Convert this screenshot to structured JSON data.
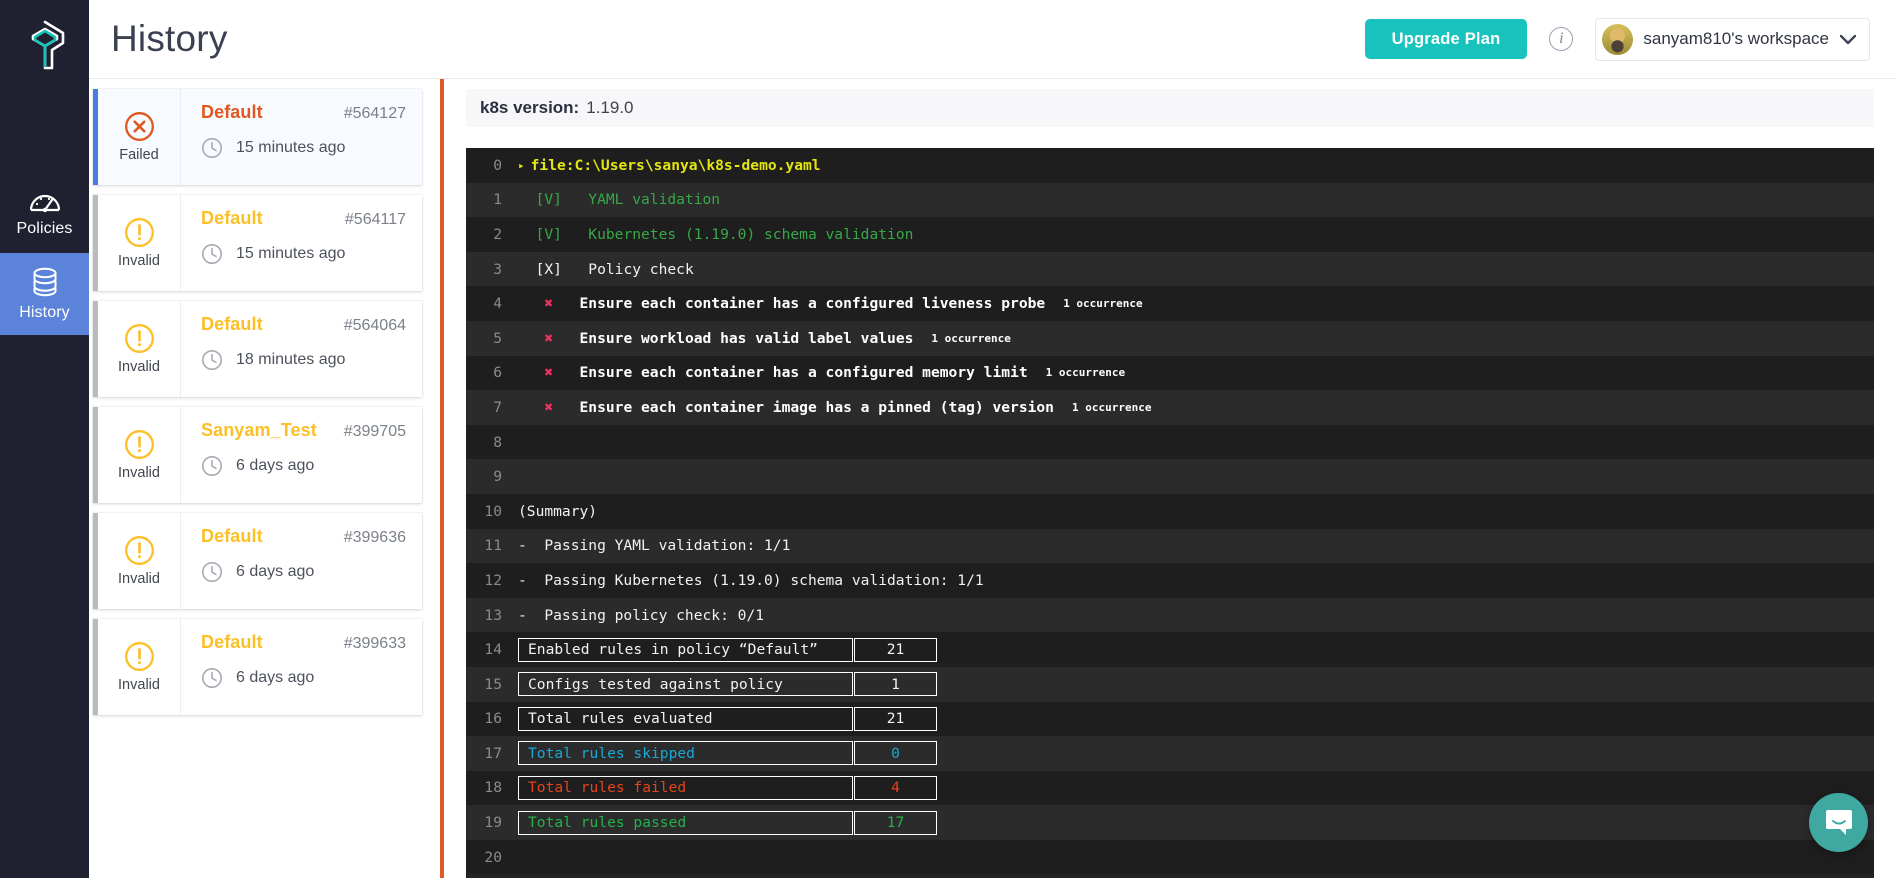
{
  "sidebar": {
    "logo_name": "datree-logo",
    "items": [
      {
        "label": "Policies",
        "icon": "gauge-icon",
        "active": false
      },
      {
        "label": "History",
        "icon": "database-stack-icon",
        "active": true
      }
    ]
  },
  "header": {
    "title": "History",
    "upgrade_label": "Upgrade Plan",
    "info_glyph": "i",
    "workspace_name": "sanyam810's workspace",
    "chevron_glyph": "⌄",
    "accent_teal": "#19c3bd"
  },
  "history": {
    "items": [
      {
        "status": "Failed",
        "status_kind": "failed",
        "policy": "Default",
        "id": "#564127",
        "time": "15 minutes ago",
        "selected": true
      },
      {
        "status": "Invalid",
        "status_kind": "invalid",
        "policy": "Default",
        "id": "#564117",
        "time": "15 minutes ago",
        "selected": false
      },
      {
        "status": "Invalid",
        "status_kind": "invalid",
        "policy": "Default",
        "id": "#564064",
        "time": "18 minutes ago",
        "selected": false
      },
      {
        "status": "Invalid",
        "status_kind": "invalid",
        "policy": "Sanyam_Test",
        "id": "#399705",
        "time": "6 days ago",
        "selected": false
      },
      {
        "status": "Invalid",
        "status_kind": "invalid",
        "policy": "Default",
        "id": "#399636",
        "time": "6 days ago",
        "selected": false
      },
      {
        "status": "Invalid",
        "status_kind": "invalid",
        "policy": "Default",
        "id": "#399633",
        "time": "6 days ago",
        "selected": false
      }
    ]
  },
  "detail": {
    "k8s_label": "k8s version:",
    "k8s_value": "1.19.0",
    "terminal": {
      "lines": [
        {
          "n": "0",
          "kind": "file",
          "text": "file:C:\\Users\\sanya\\k8s-demo.yaml"
        },
        {
          "n": "1",
          "kind": "pass",
          "mark": "[V]",
          "text": "YAML validation"
        },
        {
          "n": "2",
          "kind": "pass",
          "mark": "[V]",
          "text": "Kubernetes (1.19.0) schema validation"
        },
        {
          "n": "3",
          "kind": "failmark",
          "mark": "[X]",
          "text": "Policy check"
        },
        {
          "n": "4",
          "kind": "rule",
          "text": "Ensure each container has a configured liveness probe",
          "occ": "1 occurrence"
        },
        {
          "n": "5",
          "kind": "rule",
          "text": "Ensure workload has valid label values",
          "occ": "1 occurrence"
        },
        {
          "n": "6",
          "kind": "rule",
          "text": "Ensure each container has a configured memory limit",
          "occ": "1 occurrence"
        },
        {
          "n": "7",
          "kind": "rule",
          "text": "Ensure each container image has a pinned (tag) version",
          "occ": "1 occurrence"
        },
        {
          "n": "8",
          "kind": "blank",
          "text": ""
        },
        {
          "n": "9",
          "kind": "blank",
          "text": ""
        },
        {
          "n": "10",
          "kind": "plain",
          "text": "(Summary)"
        },
        {
          "n": "11",
          "kind": "plain",
          "text": "-  Passing YAML validation: 1/1"
        },
        {
          "n": "12",
          "kind": "plain",
          "text": "-  Passing Kubernetes (1.19.0) schema validation: 1/1"
        },
        {
          "n": "13",
          "kind": "plain",
          "text": "-  Passing policy check: 0/1"
        },
        {
          "n": "14",
          "kind": "table",
          "label": "Enabled rules in policy “Default”",
          "value": "21",
          "color": "white"
        },
        {
          "n": "15",
          "kind": "table",
          "label": "Configs tested against policy",
          "value": "1",
          "color": "white"
        },
        {
          "n": "16",
          "kind": "table",
          "label": "Total rules evaluated",
          "value": "21",
          "color": "white"
        },
        {
          "n": "17",
          "kind": "table",
          "label": "Total rules skipped",
          "value": "0",
          "color": "cyan"
        },
        {
          "n": "18",
          "kind": "table",
          "label": "Total rules failed",
          "value": "4",
          "color": "red"
        },
        {
          "n": "19",
          "kind": "table",
          "label": "Total rules passed",
          "value": "17",
          "color": "green"
        },
        {
          "n": "20",
          "kind": "blank",
          "text": ""
        }
      ]
    }
  },
  "chat": {
    "name": "intercom-chat-button",
    "color": "#3fa8a0"
  }
}
